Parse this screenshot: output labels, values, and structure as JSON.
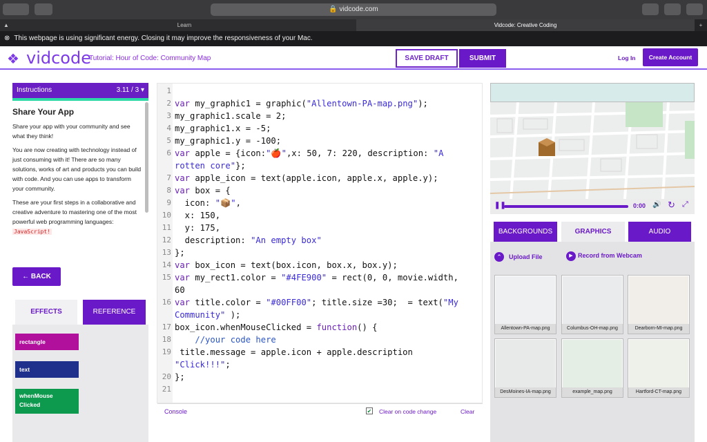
{
  "browser": {
    "url": "vidcode.com",
    "tabs": [
      "Learn",
      "Vidcode: Creative Coding"
    ],
    "banner": "This webpage is using significant energy. Closing it may improve the responsiveness of your Mac."
  },
  "header": {
    "logo": "vidcode",
    "tutorial": "Tutorial: Hour of Code: Community Map",
    "save_draft": "SAVE DRAFT",
    "submit": "SUBMIT",
    "login": "Log In",
    "create_account": "Create Account"
  },
  "instructions": {
    "label": "Instructions",
    "step": "3.11 / 3",
    "title": "Share Your App",
    "p1": "Share your app with your community and see what they think!",
    "p2": "You are now creating with technology instead of just consuming with it! There are so many solutions, works of art and products you can build with code. And you can use apps to transform your community.",
    "p3": "These are your first steps in a collaborative and creative adventure to mastering one of the most powerful web programming languages: ",
    "lang": "JavaScript!",
    "back": "← BACK"
  },
  "effects": {
    "tab_effects": "EFFECTS",
    "tab_reference": "REFERENCE",
    "items": [
      "rectangle",
      "text",
      "whenMouse Clicked"
    ],
    "colors": [
      "#b0109b",
      "#1f2f8c",
      "#0e9a4e"
    ]
  },
  "code": {
    "line_numbers": [
      "1",
      "2",
      "3",
      "4",
      "5",
      "6",
      "7",
      "8",
      "9",
      "10",
      "11",
      "12",
      "13",
      "14",
      "15",
      "16",
      "17",
      "18",
      "19",
      "20",
      "21"
    ]
  },
  "console": {
    "label": "Console",
    "clear_on_change": "Clear on code change",
    "clear": "Clear"
  },
  "player": {
    "time": "0:00"
  },
  "media_tabs": [
    "BACKGROUNDS",
    "GRAPHICS",
    "AUDIO"
  ],
  "media_actions": {
    "upload": "Upload File",
    "webcam": "Record from Webcam"
  },
  "assets": [
    "Allentown-PA-map.png",
    "Columbus-OH-map.png",
    "Dearborn-MI-map.png",
    "DesMoines-IA-map.png",
    "example_map.png",
    "Hartford-CT-map.png"
  ],
  "colors": {
    "brand_purple": "#6a19c8",
    "accent_teal": "#2fd8a7"
  }
}
